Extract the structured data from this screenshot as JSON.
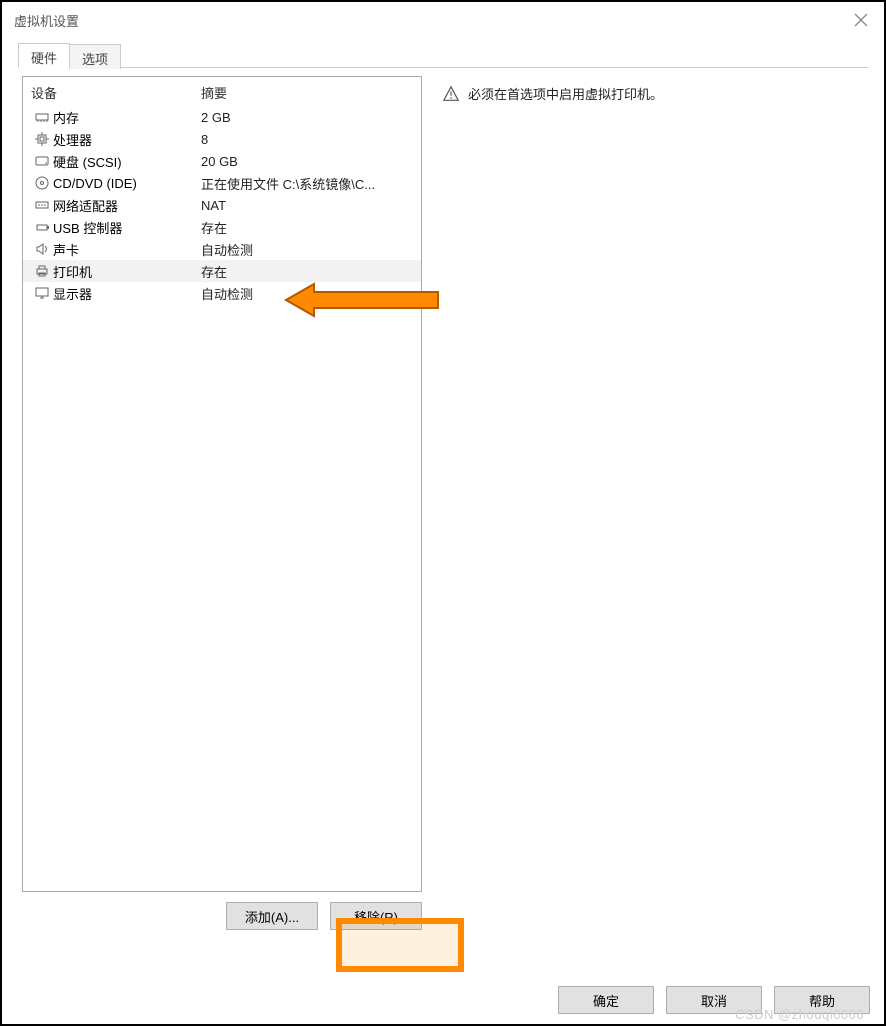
{
  "window": {
    "title": "虚拟机设置"
  },
  "tabs": [
    {
      "label": "硬件",
      "active": true
    },
    {
      "label": "选项",
      "active": false
    }
  ],
  "device_table": {
    "headers": {
      "device": "设备",
      "summary": "摘要"
    },
    "rows": [
      {
        "icon": "memory-icon",
        "name": "内存",
        "summary": "2 GB",
        "selected": false
      },
      {
        "icon": "cpu-icon",
        "name": "处理器",
        "summary": "8",
        "selected": false
      },
      {
        "icon": "disk-icon",
        "name": "硬盘 (SCSI)",
        "summary": "20 GB",
        "selected": false
      },
      {
        "icon": "cd-icon",
        "name": "CD/DVD (IDE)",
        "summary": "正在使用文件 C:\\系统镜像\\C...",
        "selected": false
      },
      {
        "icon": "network-icon",
        "name": "网络适配器",
        "summary": "NAT",
        "selected": false
      },
      {
        "icon": "usb-icon",
        "name": "USB 控制器",
        "summary": "存在",
        "selected": false
      },
      {
        "icon": "sound-icon",
        "name": "声卡",
        "summary": "自动检测",
        "selected": false
      },
      {
        "icon": "printer-icon",
        "name": "打印机",
        "summary": "存在",
        "selected": true
      },
      {
        "icon": "display-icon",
        "name": "显示器",
        "summary": "自动检测",
        "selected": false
      }
    ]
  },
  "buttons": {
    "add": "添加(A)...",
    "remove": "移除(R)"
  },
  "right_panel": {
    "warning": "必须在首选项中启用虚拟打印机。"
  },
  "footer": {
    "ok": "确定",
    "cancel": "取消",
    "help": "帮助"
  },
  "watermark": "CSDN @zhouqi6666"
}
